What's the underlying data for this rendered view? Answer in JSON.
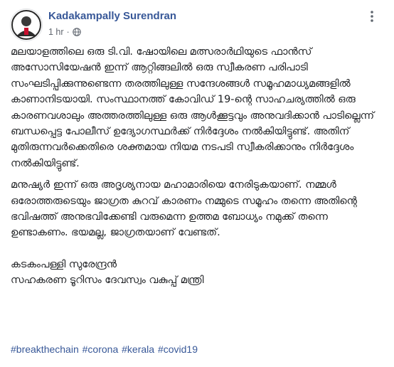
{
  "post": {
    "author": "Kadakampally Surendran",
    "time": "1 hr",
    "dot": "·",
    "privacy_icon": "globe-icon",
    "more_icon": "more-options-icon",
    "paragraphs": [
      "മലയാളത്തിലെ ഒരു ടി.വി. ഷോയിലെ മത്സരാർഥിയുടെ ഫാൻസ് അസോസിയേഷൻ ഇന്ന് ആറ്റിങ്ങലിൽ ഒരു സ്വീകരണ പരിപാടി സംഘടിപ്പിക്കുന്നുണ്ടെന്ന തരത്തിലുള്ള സന്ദേശങ്ങൾ സമൂഹമാധ്യമങ്ങളിൽ കാണാനിടയായി. സംസ്ഥാനത്ത് കോവിഡ് 19-ന്റെ സാഹചര്യത്തിൽ ഒരു കാരണവശാലും അത്തരത്തിലുള്ള ഒരു ആൾക്കൂട്ടവും അനുവദിക്കാൻ പാടില്ലെന്ന് ബന്ധപ്പെട്ട പോലീസ് ഉദ്യോഗസ്ഥർക്ക് നിർദ്ദേശം നൽകിയിട്ടുണ്ട്. അതിന് മുതിരുന്നവർക്കെതിരെ ശക്തമായ നിയമ നടപടി സ്വീകരിക്കാനും നിർദ്ദേശം നൽകിയിട്ടുണ്ട്.",
      "മനുഷ്യർ ഇന്ന് ഒരു അദൃശ്യനായ മഹാമാരിയെ നേരിടുകയാണ്. നമ്മൾ ഒരോത്തരുടെയും ജാഗ്രത കുറവ് കാരണം നമ്മുടെ സമൂഹം തന്നെ അതിന്റെ ഭവിഷത്ത് അനുഭവിക്കേണ്ടി വരുമെന്ന ഉത്തമ ബോധ്യം നമുക്ക് തന്നെ ഉണ്ടാകണം. ഭയമല്ല, ജാഗ്രതയാണ് വേണ്ടത്."
    ],
    "signature": {
      "name": "കടകംപള്ളി സുരേന്ദ്രൻ",
      "role": "സഹകരണ ടൂറിസം ദേവസ്വം വകുപ്പ് മന്ത്രി"
    },
    "hashtags": [
      "#breakthechain",
      "#corona",
      "#kerala",
      "#covid19"
    ]
  },
  "colors": {
    "link": "#385898",
    "meta": "#616770",
    "text": "#1c1e21"
  }
}
